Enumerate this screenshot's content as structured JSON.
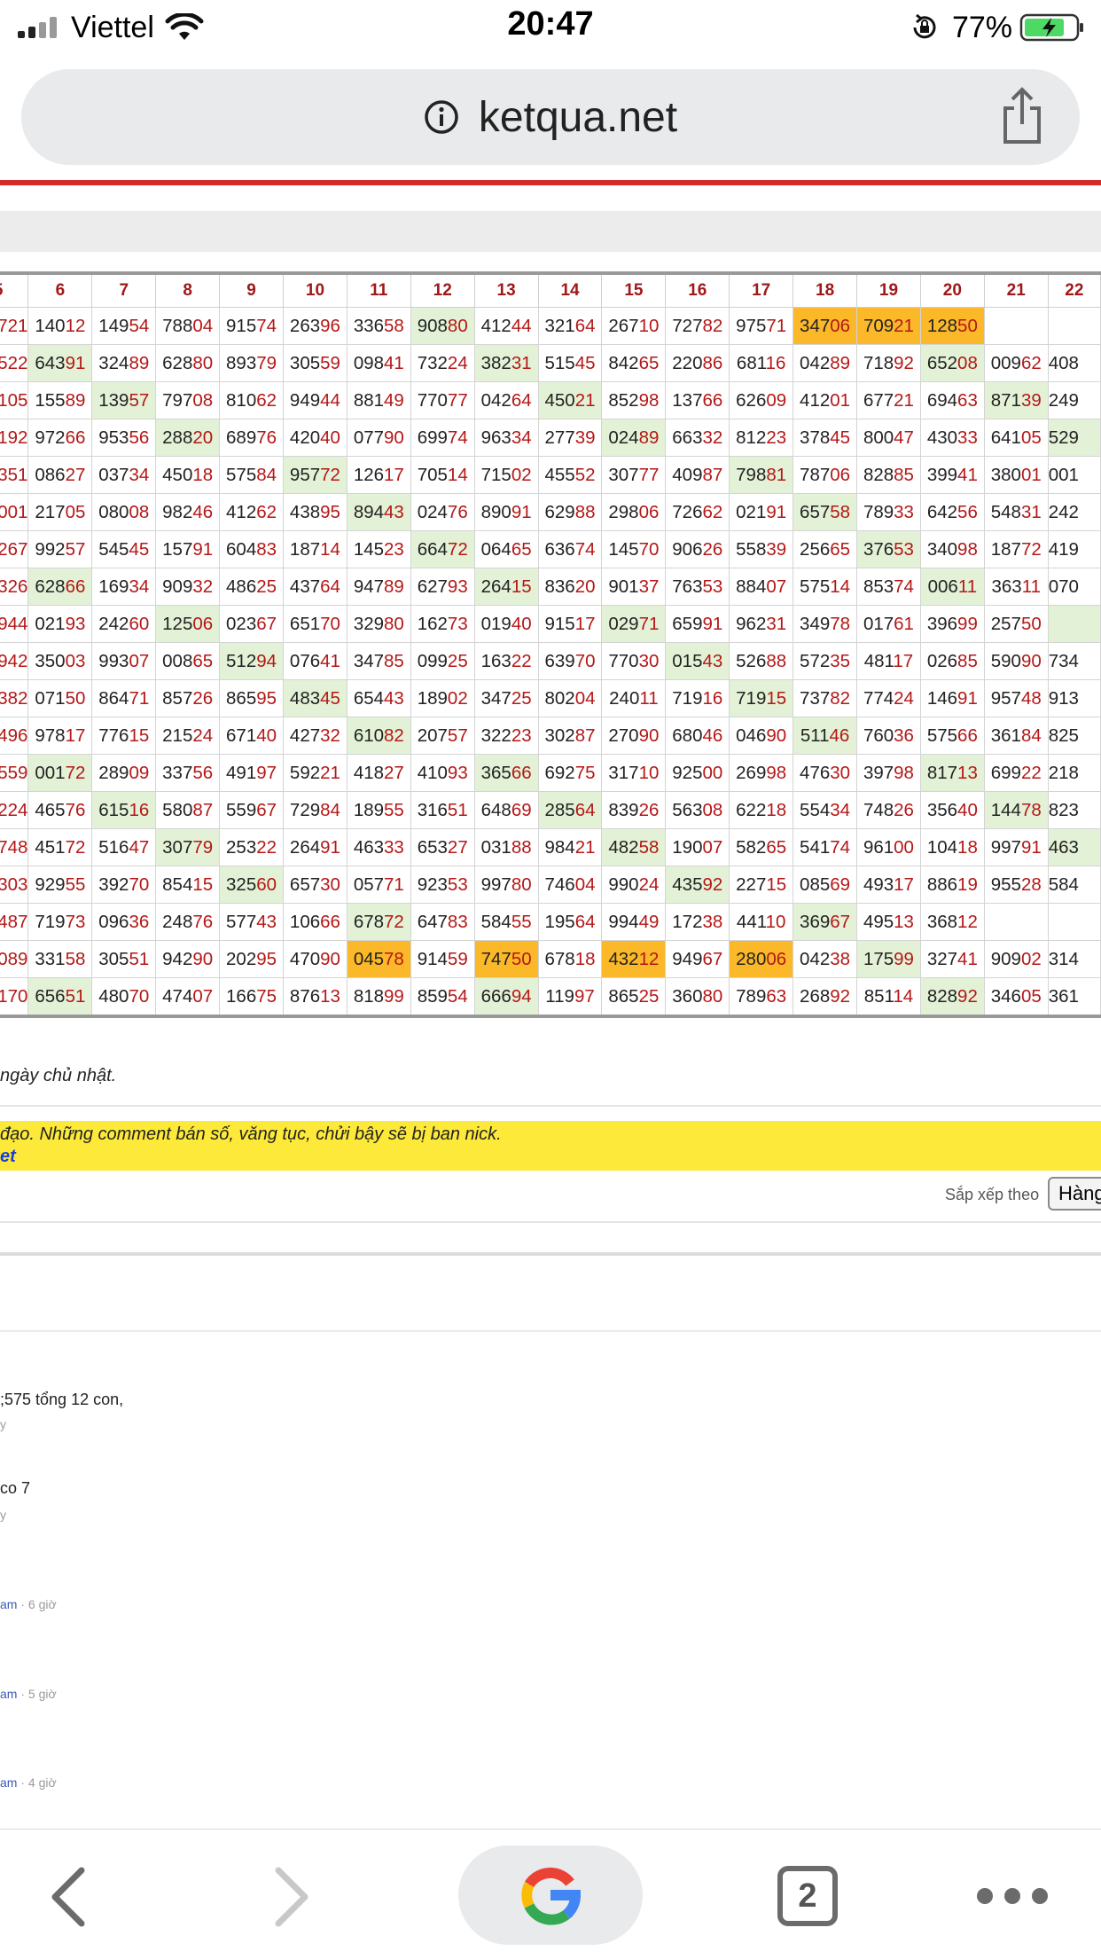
{
  "status_bar": {
    "carrier": "Viettel",
    "time": "20:47",
    "battery": "77%"
  },
  "browser": {
    "url": "ketqua.net"
  },
  "table": {
    "headers": [
      "5",
      "6",
      "7",
      "8",
      "9",
      "10",
      "11",
      "12",
      "13",
      "14",
      "15",
      "16",
      "17",
      "18",
      "19",
      "20",
      "21",
      "22"
    ],
    "rows": [
      [
        "721|",
        "140|12",
        "149|54",
        "788|04",
        "915|74",
        "263|96",
        "336|58",
        "908|80|g",
        "412|44",
        "321|64",
        "267|10",
        "727|82",
        "975|71",
        "347|06|o",
        "709|21|o",
        "128|50|o",
        "",
        ""
      ],
      [
        "522|",
        "643|91|g",
        "324|89",
        "628|80",
        "893|79",
        "305|59",
        "098|41",
        "732|24",
        "382|31|g",
        "515|45",
        "842|65",
        "220|86",
        "681|16",
        "042|89",
        "718|92",
        "652|08|g",
        "009|62",
        "408|"
      ],
      [
        "105|",
        "155|89",
        "139|57|g",
        "797|08",
        "810|62",
        "949|44",
        "881|49",
        "770|77",
        "042|64",
        "450|21|g",
        "852|98",
        "137|66",
        "626|09",
        "412|01",
        "677|21",
        "694|63",
        "871|39|g",
        "249|"
      ],
      [
        "192|",
        "972|66",
        "953|56",
        "288|20|g",
        "689|76",
        "420|40",
        "077|90",
        "699|74",
        "963|34",
        "277|39",
        "024|89|g",
        "663|32",
        "812|23",
        "378|45",
        "800|47",
        "430|33",
        "641|05",
        "529|g"
      ],
      [
        "351|",
        "086|27",
        "037|34",
        "450|18",
        "575|84",
        "957|72|g",
        "126|17",
        "705|14",
        "715|02",
        "455|52",
        "307|77",
        "409|87",
        "798|81|g",
        "787|06",
        "828|85",
        "399|41",
        "380|01",
        "001|"
      ],
      [
        "001|",
        "217|05",
        "080|08",
        "982|46",
        "412|62",
        "438|95",
        "894|43|g",
        "024|76",
        "890|91",
        "629|88",
        "298|06",
        "726|62",
        "021|91",
        "657|58|g",
        "789|33",
        "642|56",
        "548|31",
        "242|"
      ],
      [
        "267|",
        "992|57",
        "545|45",
        "157|91",
        "604|83",
        "187|14",
        "145|23",
        "664|72|g",
        "064|65",
        "636|74",
        "145|70",
        "906|26",
        "558|39",
        "256|65",
        "376|53|g",
        "340|98",
        "187|72",
        "419|"
      ],
      [
        "326|",
        "628|66|g",
        "169|34",
        "909|32",
        "486|25",
        "437|64",
        "947|89",
        "627|93",
        "264|15|g",
        "836|20",
        "901|37",
        "763|53",
        "884|07",
        "575|14",
        "853|74",
        "006|11|g",
        "363|11",
        "070|"
      ],
      [
        "944|",
        "021|93",
        "242|60",
        "125|06|g",
        "023|67",
        "651|70",
        "329|80",
        "162|73",
        "019|40",
        "915|17",
        "029|71|g",
        "659|91",
        "962|31",
        "349|78",
        "017|61",
        "396|99",
        "257|50",
        "|g"
      ],
      [
        "942|",
        "350|03",
        "993|07",
        "008|65",
        "512|94|g",
        "076|41",
        "347|85",
        "099|25",
        "163|22",
        "639|70",
        "770|30",
        "015|43|g",
        "526|88",
        "572|35",
        "481|17",
        "026|85",
        "590|90",
        "734|"
      ],
      [
        "382|",
        "071|50",
        "864|71",
        "857|26",
        "865|95",
        "483|45|g",
        "654|43",
        "189|02",
        "347|25",
        "802|04",
        "240|11",
        "719|16",
        "719|15|g",
        "737|82",
        "774|24",
        "146|91",
        "957|48",
        "913|"
      ],
      [
        "496|",
        "978|17",
        "776|15",
        "215|24",
        "671|40",
        "427|32",
        "610|82|g",
        "207|57",
        "322|23",
        "302|87",
        "270|90",
        "680|46",
        "046|90",
        "511|46|g",
        "760|36",
        "575|66",
        "361|84",
        "825|"
      ],
      [
        "559|",
        "001|72|g",
        "289|09",
        "337|56",
        "491|97",
        "592|21",
        "418|27",
        "410|93",
        "365|66|g",
        "692|75",
        "317|10",
        "925|00",
        "269|98",
        "476|30",
        "397|98",
        "817|13|g",
        "699|22",
        "218|"
      ],
      [
        "224|",
        "465|76",
        "615|16|g",
        "580|87",
        "559|67",
        "729|84",
        "189|55",
        "316|51",
        "648|69",
        "285|64|g",
        "839|26",
        "563|08",
        "622|18",
        "554|34",
        "748|26",
        "356|40",
        "144|78|g",
        "823|"
      ],
      [
        "748|",
        "451|72",
        "516|47",
        "307|79|g",
        "253|22",
        "264|91",
        "463|33",
        "653|27",
        "031|88",
        "984|21",
        "482|58|g",
        "190|07",
        "582|65",
        "541|74",
        "961|00",
        "104|18",
        "997|91",
        "463|g"
      ],
      [
        "303|",
        "929|55",
        "392|70",
        "854|15",
        "325|60|g",
        "657|30",
        "057|71",
        "923|53",
        "997|80",
        "746|04",
        "990|24",
        "435|92|g",
        "227|15",
        "085|69",
        "493|17",
        "886|19",
        "955|28",
        "584|"
      ],
      [
        "487|",
        "719|73",
        "096|36",
        "248|76",
        "577|43",
        "106|66",
        "678|72|g",
        "647|83",
        "584|55",
        "195|64",
        "994|49",
        "172|38",
        "441|10",
        "369|67|g",
        "495|13",
        "368|12",
        "",
        ""
      ],
      [
        "089|",
        "331|58",
        "305|51",
        "942|90",
        "202|95",
        "470|90",
        "045|78|o",
        "914|59",
        "747|50|o",
        "678|18",
        "432|12|o",
        "949|67",
        "280|06|o",
        "042|38",
        "175|99|g",
        "327|41",
        "909|02",
        "314|"
      ],
      [
        "170|",
        "656|51|g",
        "480|70",
        "474|07",
        "166|75",
        "876|13",
        "818|99",
        "859|54",
        "666|94|g",
        "119|97",
        "865|25",
        "360|80",
        "789|63",
        "268|92",
        "851|14",
        "828|92|g",
        "346|05",
        "361|"
      ]
    ]
  },
  "note": "ngày chủ nhật.",
  "warning": {
    "line1": "đạo. Những comment bán số, văng tục, chửi bậy sẽ bị ban nick.",
    "line2": "et"
  },
  "sort": {
    "label": "Sắp xếp theo",
    "button": "Hàng"
  },
  "comments": [
    {
      "text": ";575 tổng 12 con,",
      "meta": "y"
    },
    {
      "text": "co 7",
      "meta": "y"
    },
    {
      "link": "am",
      "meta": " · 6 giờ"
    },
    {
      "link": "am",
      "meta": " · 5 giờ"
    },
    {
      "link": "am",
      "meta": " · 4 giờ"
    }
  ],
  "bottom_nav": {
    "tabs_count": "2"
  },
  "colors": {
    "accent_red": "#d42a2a",
    "highlight_green": "#e3f2d6",
    "highlight_orange": "#fbb829",
    "digit_red": "#b51717",
    "warning_yellow": "#fce939"
  },
  "icons": [
    "signal-icon",
    "wifi-icon",
    "rotation-lock-icon",
    "battery-icon",
    "info-icon",
    "share-icon",
    "back-icon",
    "forward-icon",
    "google-icon",
    "tabs-icon",
    "more-icon"
  ]
}
